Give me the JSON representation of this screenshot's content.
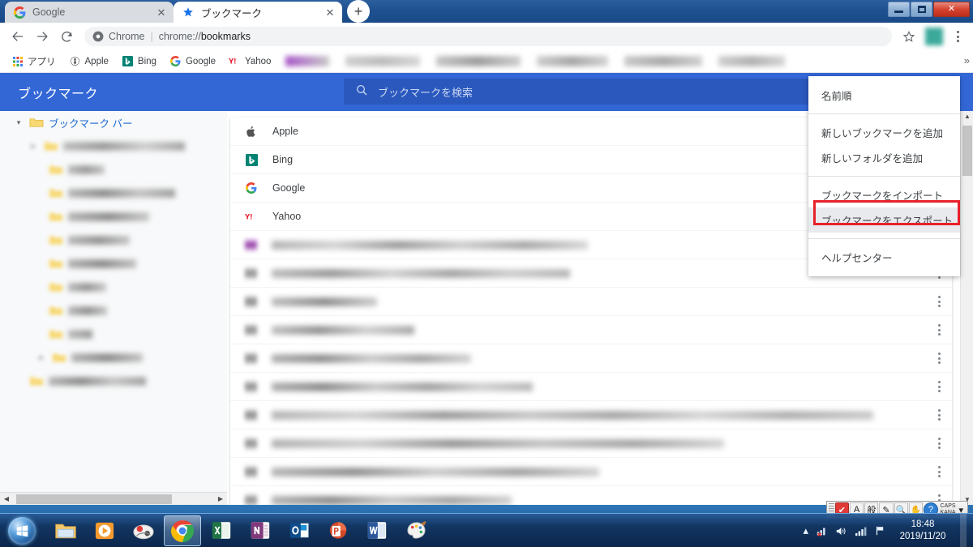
{
  "window": {
    "controls": {
      "minimize": "–",
      "maximize": "❐",
      "close": "✕"
    }
  },
  "tabs": [
    {
      "title": "Google",
      "favicon": "google-icon",
      "close": "✕",
      "active": false
    },
    {
      "title": "ブックマーク",
      "favicon": "star-icon",
      "close": "✕",
      "active": true
    }
  ],
  "newtab_label": "+",
  "toolbar": {
    "back": "←",
    "forward": "→",
    "reload": "⟳",
    "omnibox": {
      "chip_label": "Chrome",
      "separator": "|",
      "url_prefix": "chrome://",
      "url_rest": "bookmarks",
      "full_url": "chrome://bookmarks"
    },
    "star": "☆",
    "menu": "kebab-menu"
  },
  "bookmarks_bar": {
    "apps_label": "アプリ",
    "items": [
      {
        "label": "Apple",
        "icon": "apple-globe-icon"
      },
      {
        "label": "Bing",
        "icon": "bing-icon"
      },
      {
        "label": "Google",
        "icon": "google-icon"
      },
      {
        "label": "Yahoo",
        "icon": "yahoo-icon"
      }
    ],
    "blurred_count": 5,
    "overflow": "»"
  },
  "manager": {
    "title": "ブックマーク",
    "search_placeholder": "ブックマークを検索",
    "search_icon": "search-icon"
  },
  "sidebar": {
    "root": {
      "label": "ブックマーク バー",
      "expanded": true,
      "arrow": "▾"
    },
    "blurred_items": 10
  },
  "list": {
    "items": [
      {
        "name": "Apple",
        "icon": "apple-icon",
        "blurred": false
      },
      {
        "name": "Bing",
        "icon": "bing-icon",
        "blurred": false
      },
      {
        "name": "Google",
        "icon": "google-icon",
        "blurred": false
      },
      {
        "name": "Yahoo",
        "icon": "yahoo-icon",
        "blurred": false
      }
    ],
    "blurred_rows": 11,
    "row_menu_icon": "kebab-menu-icon"
  },
  "menu": {
    "groups": [
      {
        "items": [
          {
            "label": "名前順",
            "highlighted": false
          }
        ]
      },
      {
        "items": [
          {
            "label": "新しいブックマークを追加",
            "highlighted": false
          },
          {
            "label": "新しいフォルダを追加",
            "highlighted": false
          }
        ]
      },
      {
        "items": [
          {
            "label": "ブックマークをインポート",
            "highlighted": false
          },
          {
            "label": "ブックマークをエクスポート",
            "highlighted": true
          }
        ]
      },
      {
        "items": [
          {
            "label": "ヘルプセンター",
            "highlighted": false
          }
        ]
      }
    ],
    "highlight_color": "#e8202a"
  },
  "ime": {
    "mode_alpha": "A",
    "mode_kana": "般",
    "caps_label": "CAPS",
    "kana_label": "KANA",
    "help": "?",
    "arrow": "▾"
  },
  "taskbar": {
    "start": "start-orb",
    "items": [
      {
        "name": "explorer",
        "active": false
      },
      {
        "name": "media-player",
        "active": false
      },
      {
        "name": "custom-app",
        "active": false
      },
      {
        "name": "chrome",
        "active": true
      },
      {
        "name": "excel",
        "active": false
      },
      {
        "name": "onenote",
        "active": false
      },
      {
        "name": "outlook",
        "active": false
      },
      {
        "name": "powerpoint",
        "active": false
      },
      {
        "name": "word",
        "active": false
      },
      {
        "name": "paint",
        "active": false
      }
    ],
    "tray": {
      "show_hidden": "▴",
      "network": "network-icon",
      "volume": "volume-icon",
      "signal": "signal-icon",
      "flag": "action-center-icon",
      "time": "18:48",
      "date": "2019/11/20"
    }
  },
  "colors": {
    "header_blue": "#3367d6",
    "search_blue": "#2a58bd",
    "tab_active": "#ffffff",
    "tab_inactive": "#d9dce0",
    "frame_blue": "#1f5191",
    "link_blue": "#1967d2",
    "annotation_red": "#e8202a",
    "menu_highlight": "#e8eaed"
  }
}
